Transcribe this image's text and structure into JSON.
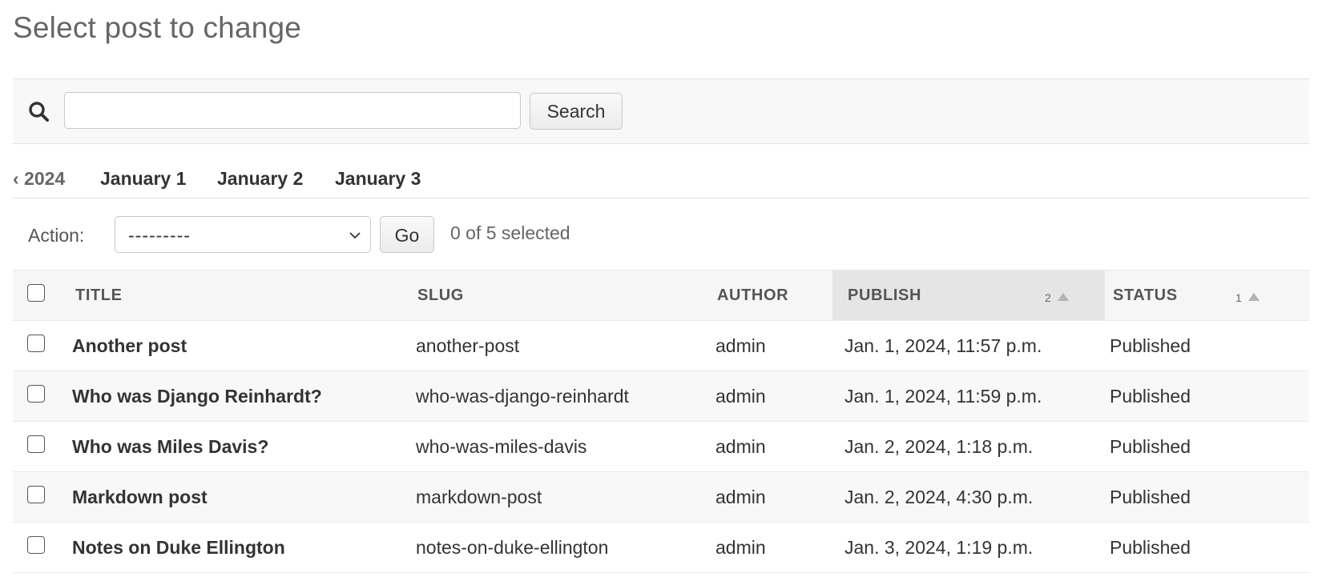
{
  "page_title": "Select post to change",
  "search": {
    "value": "",
    "placeholder": "",
    "button_label": "Search",
    "icon": "search-icon"
  },
  "date_hierarchy": {
    "back_label": "‹ 2024",
    "days": [
      "January 1",
      "January 2",
      "January 3"
    ]
  },
  "actions": {
    "label": "Action:",
    "selected_value": "---------",
    "go_label": "Go",
    "selected_count": "0 of 5 selected"
  },
  "table": {
    "columns": [
      {
        "label": "TITLE"
      },
      {
        "label": "SLUG"
      },
      {
        "label": "AUTHOR"
      },
      {
        "label": "PUBLISH",
        "sort_priority": "2",
        "sort_direction": "ascending"
      },
      {
        "label": "STATUS",
        "sort_priority": "1",
        "sort_direction": "ascending"
      }
    ],
    "rows": [
      {
        "title": "Another post",
        "slug": "another-post",
        "author": "admin",
        "publish": "Jan. 1, 2024, 11:57 p.m.",
        "status": "Published"
      },
      {
        "title": "Who was Django Reinhardt?",
        "slug": "who-was-django-reinhardt",
        "author": "admin",
        "publish": "Jan. 1, 2024, 11:59 p.m.",
        "status": "Published"
      },
      {
        "title": "Who was Miles Davis?",
        "slug": "who-was-miles-davis",
        "author": "admin",
        "publish": "Jan. 2, 2024, 1:18 p.m.",
        "status": "Published"
      },
      {
        "title": "Markdown post",
        "slug": "markdown-post",
        "author": "admin",
        "publish": "Jan. 2, 2024, 4:30 p.m.",
        "status": "Published"
      },
      {
        "title": "Notes on Duke Ellington",
        "slug": "notes-on-duke-ellington",
        "author": "admin",
        "publish": "Jan. 3, 2024, 1:19 p.m.",
        "status": "Published"
      }
    ]
  },
  "colors": {
    "header_bg": "#f6f6f6",
    "sorted_header_bg": "#e5e5e5",
    "alt_row_bg": "#f8f8f8",
    "text": "#333333",
    "muted_text": "#666666"
  }
}
